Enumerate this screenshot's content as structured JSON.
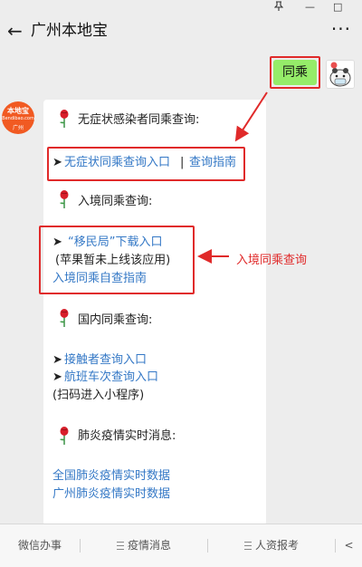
{
  "window": {
    "pin_icon": "pin-icon",
    "min_symbol": "—",
    "max_symbol": "□"
  },
  "header": {
    "back_symbol": "←",
    "title": "广州本地宝",
    "more_symbol": "···"
  },
  "sent_message": {
    "text": "同乘"
  },
  "bot": {
    "avatar_line1": "本地宝",
    "avatar_line2": "Bendibao.com",
    "avatar_line3": "广州"
  },
  "card": {
    "section1_title": "无症状感染者同乘查询:",
    "section1_arrow": "➤",
    "section1_link1": "无症状同乘查询入口",
    "section1_sep": "|",
    "section1_link2": "查询指南",
    "section2_title": "入境同乘查询:",
    "section2_arrow": "➤",
    "section2_link1": "“移民局”下载入口",
    "section2_note": "(苹果暂未上线该应用)",
    "section2_link2": "入境同乘自查指南",
    "section3_title": "国内同乘查询:",
    "section3_arrow1": "➤",
    "section3_link1": "接触者查询入口",
    "section3_arrow2": "➤",
    "section3_link2": "航班车次查询入口",
    "section3_note": "(扫码进入小程序)",
    "section4_title": "肺炎疫情实时消息:",
    "section4_link1": "全国肺炎疫情实时数据",
    "section4_link2": "广州肺炎疫情实时数据"
  },
  "annotation": {
    "text": "入境同乘查询"
  },
  "bottom_menu": {
    "items": [
      "微信办事",
      "疫情消息",
      "人资报考"
    ],
    "partial_symbol": "<"
  },
  "colors": {
    "accent_red": "#e02a2a",
    "link_blue": "#3478c6",
    "bubble_green": "#95ec69",
    "brand_orange": "#f15a22"
  }
}
